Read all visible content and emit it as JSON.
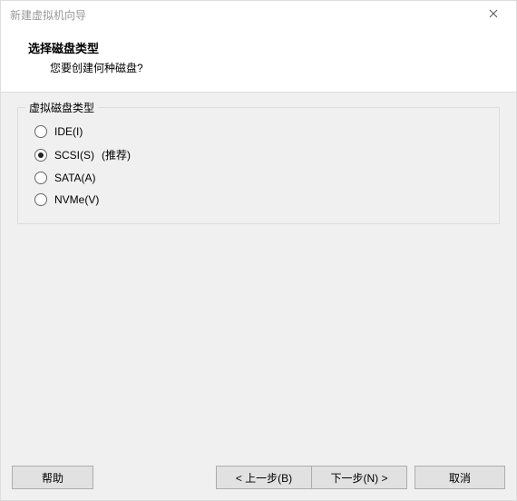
{
  "window": {
    "title": "新建虚拟机向导"
  },
  "header": {
    "heading": "选择磁盘类型",
    "subheading": "您要创建何种磁盘?"
  },
  "group": {
    "legend": "虚拟磁盘类型",
    "options": [
      {
        "label": "IDE(I)",
        "suffix": "",
        "selected": false
      },
      {
        "label": "SCSI(S)",
        "suffix": "(推荐)",
        "selected": true
      },
      {
        "label": "SATA(A)",
        "suffix": "",
        "selected": false
      },
      {
        "label": "NVMe(V)",
        "suffix": "",
        "selected": false
      }
    ]
  },
  "footer": {
    "help": "帮助",
    "back": "< 上一步(B)",
    "next": "下一步(N) >",
    "cancel": "取消"
  }
}
